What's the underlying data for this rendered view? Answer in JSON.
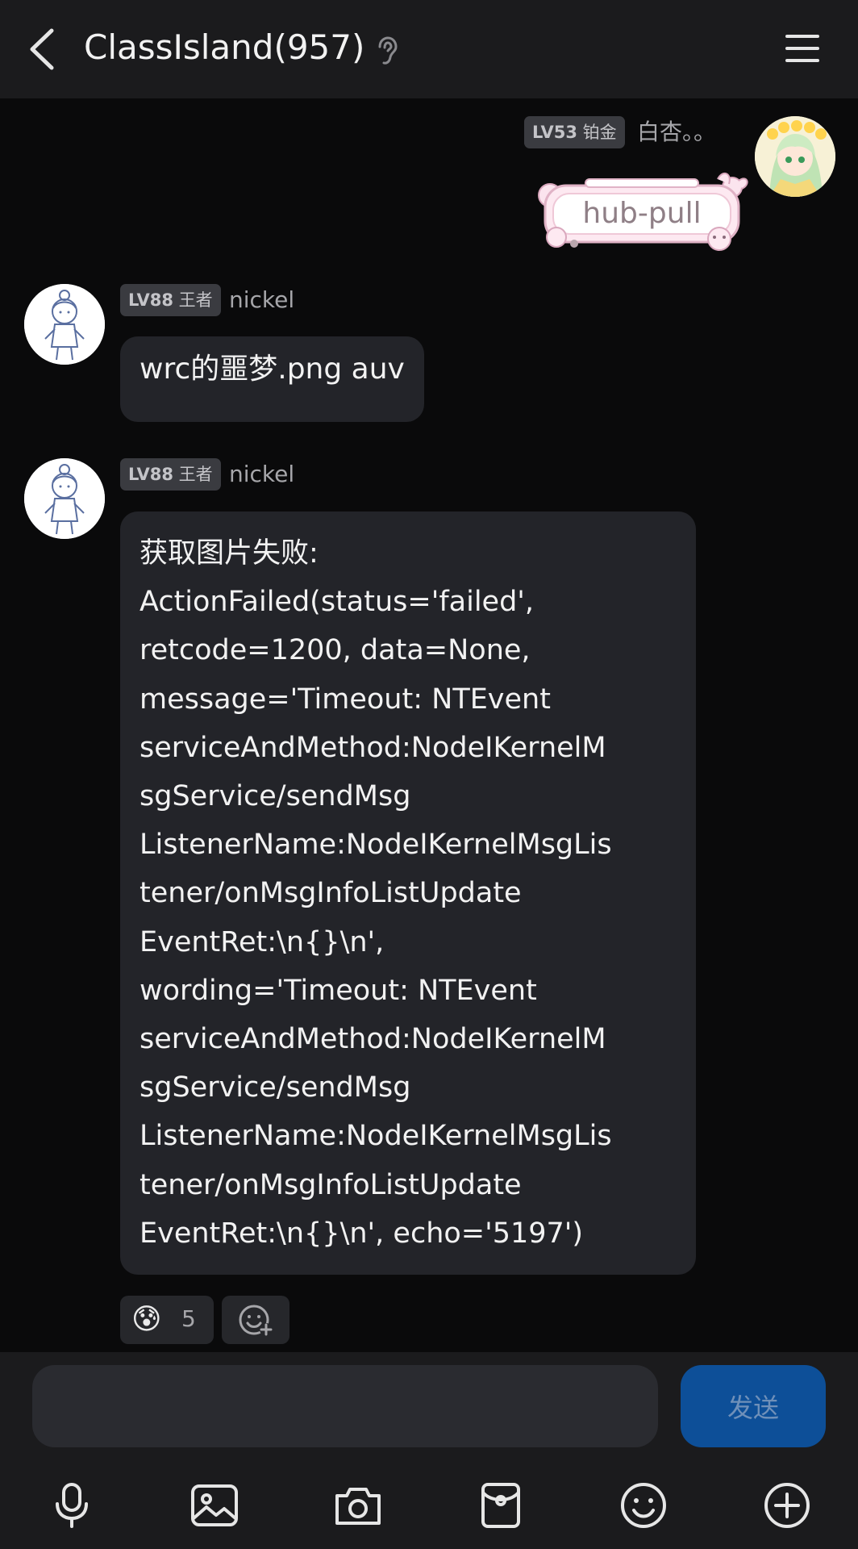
{
  "header": {
    "title": "ClassIsland(957)"
  },
  "messages": [
    {
      "side": "right",
      "level": "LV53",
      "rank": "铂金",
      "nickname": "白杏。。",
      "sticker_text": "hub-pull"
    },
    {
      "side": "left",
      "level": "LV88",
      "rank": "王者",
      "nickname": "nickel",
      "text": "wrc的噩梦.png auv"
    },
    {
      "side": "left",
      "level": "LV88",
      "rank": "王者",
      "nickname": "nickel",
      "text": "获取图片失败:\nActionFailed(status='failed',\nretcode=1200, data=None,\nmessage='Timeout: NTEvent\nserviceAndMethod:NodeIKernelM\nsgService/sendMsg\nListenerName:NodeIKernelMsgLis\ntener/onMsgInfoListUpdate\nEventRet:\\n{}\\n',\nwording='Timeout: NTEvent\nserviceAndMethod:NodeIKernelM\nsgService/sendMsg\nListenerName:NodeIKernelMsgLis\ntener/onMsgInfoListUpdate\nEventRet:\\n{}\\n', echo='5197')",
      "reactions": [
        {
          "emoji": "😰",
          "count": "5"
        }
      ]
    }
  ],
  "input": {
    "value": "",
    "send_label": "发送"
  },
  "toolbar": {
    "icons": [
      "microphone-icon",
      "image-icon",
      "camera-icon",
      "red-packet-icon",
      "emoji-icon",
      "plus-icon"
    ]
  },
  "colors": {
    "background": "#0a0a0b",
    "header": "#1b1b1d",
    "bubble": "#232429",
    "send_button": "#0d4f98"
  }
}
